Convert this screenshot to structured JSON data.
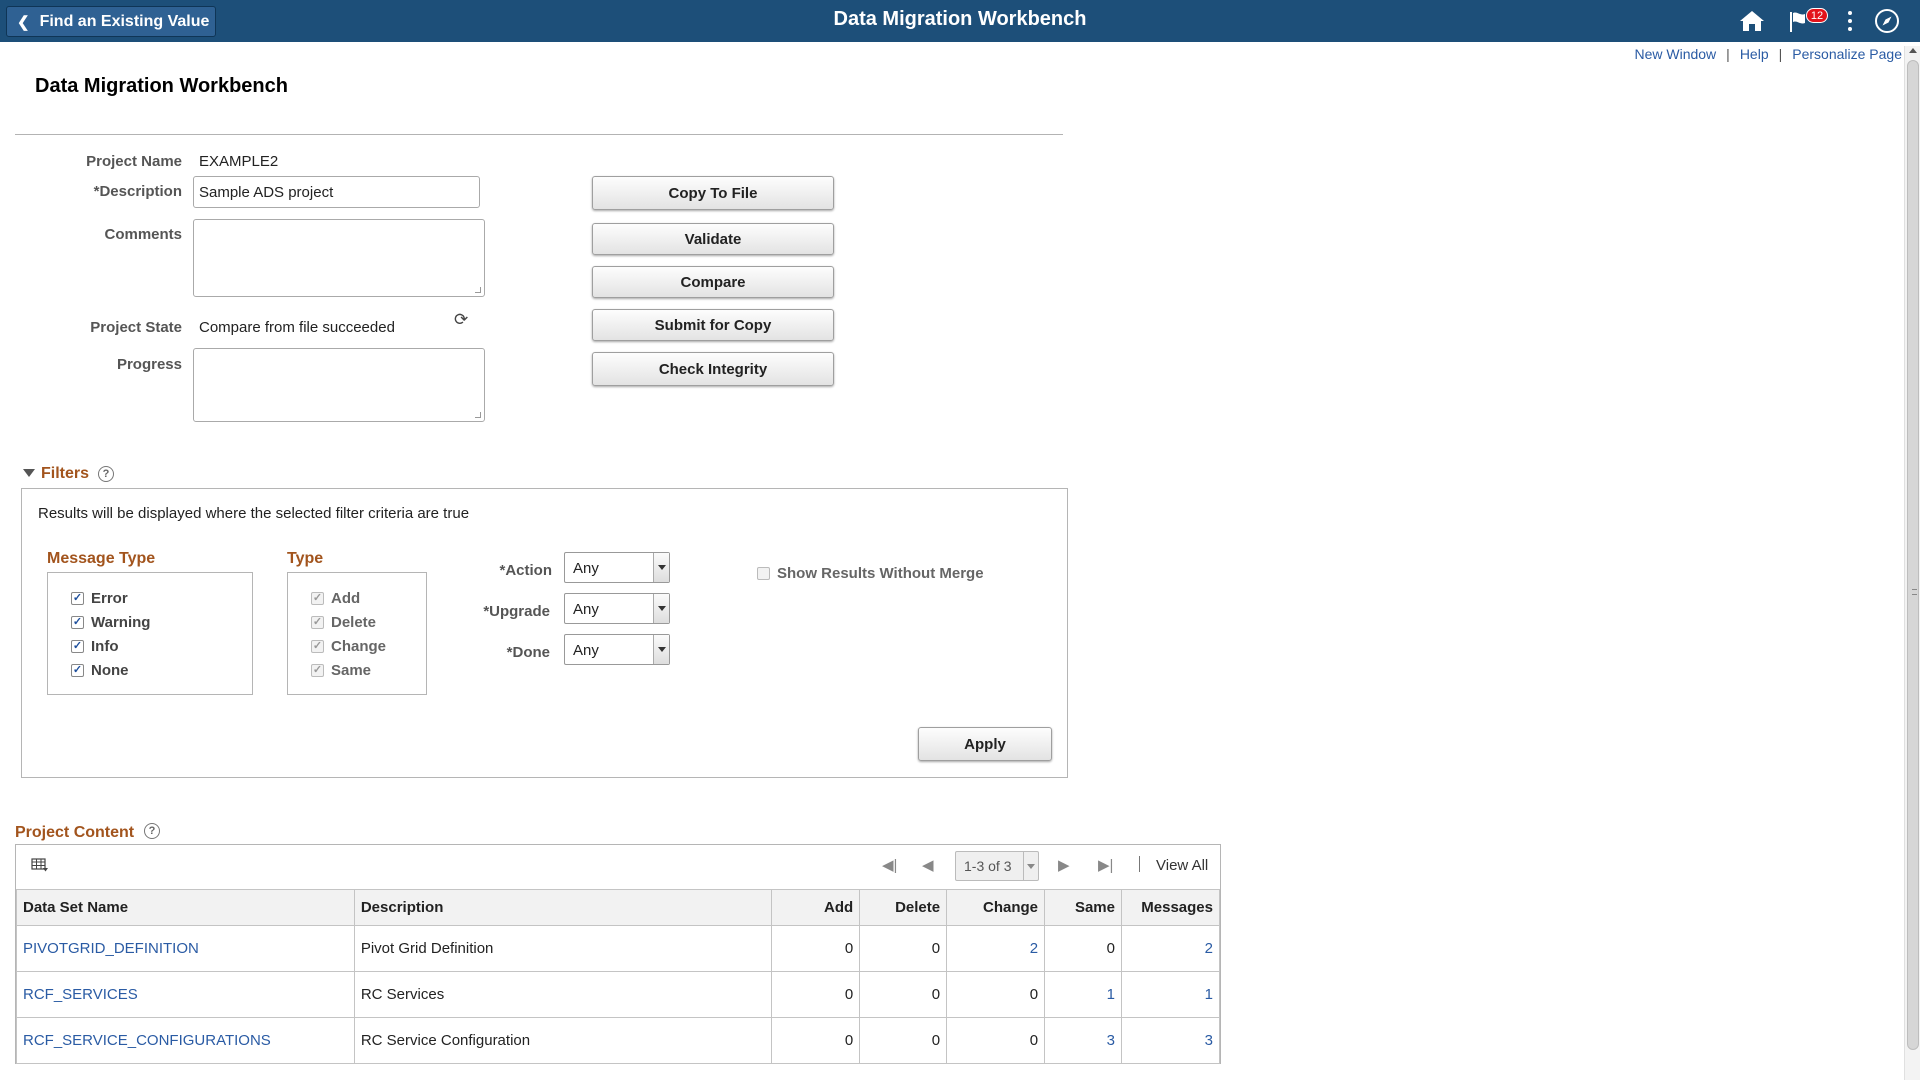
{
  "banner": {
    "back_label": "Find an Existing Value",
    "title": "Data Migration Workbench",
    "notification_count": "12"
  },
  "toplinks": {
    "new_window": "New Window",
    "help": "Help",
    "personalize": "Personalize Page"
  },
  "page": {
    "title": "Data Migration Workbench"
  },
  "form": {
    "project_name_label": "Project Name",
    "project_name": "EXAMPLE2",
    "description_label": "*Description",
    "description_value": "Sample ADS project",
    "comments_label": "Comments",
    "comments_value": "",
    "project_state_label": "Project State",
    "project_state": "Compare from file succeeded",
    "progress_label": "Progress",
    "progress_value": ""
  },
  "actions": {
    "copy_to_file": "Copy To File",
    "validate": "Validate",
    "compare": "Compare",
    "submit_for_copy": "Submit for Copy",
    "check_integrity": "Check Integrity"
  },
  "filters": {
    "title": "Filters",
    "hint": "Results will be displayed where the selected filter criteria are true",
    "message_type": {
      "title": "Message Type",
      "items": [
        {
          "label": "Error",
          "checked": true
        },
        {
          "label": "Warning",
          "checked": true
        },
        {
          "label": "Info",
          "checked": true
        },
        {
          "label": "None",
          "checked": true
        }
      ]
    },
    "type": {
      "title": "Type",
      "items": [
        {
          "label": "Add",
          "checked": true
        },
        {
          "label": "Delete",
          "checked": true
        },
        {
          "label": "Change",
          "checked": true
        },
        {
          "label": "Same",
          "checked": true
        }
      ]
    },
    "action_label": "*Action",
    "action_value": "Any",
    "upgrade_label": "*Upgrade",
    "upgrade_value": "Any",
    "done_label": "*Done",
    "done_value": "Any",
    "show_without_merge": "Show Results Without Merge",
    "apply": "Apply"
  },
  "content": {
    "title": "Project Content",
    "pager": "1-3 of 3",
    "view_all": "View All",
    "columns": [
      "Data Set Name",
      "Description",
      "Add",
      "Delete",
      "Change",
      "Same",
      "Messages"
    ],
    "rows": [
      {
        "name": "PIVOTGRID_DEFINITION",
        "description": "Pivot Grid Definition",
        "add": "0",
        "delete": "0",
        "change": "2",
        "same": "0",
        "messages": "2"
      },
      {
        "name": "RCF_SERVICES",
        "description": "RC Services",
        "add": "0",
        "delete": "0",
        "change": "0",
        "same": "1",
        "messages": "1"
      },
      {
        "name": "RCF_SERVICE_CONFIGURATIONS",
        "description": "RC Service Configuration",
        "add": "0",
        "delete": "0",
        "change": "0",
        "same": "3",
        "messages": "3"
      }
    ]
  },
  "colors": {
    "banner": "#1d4f79",
    "section": "#a2541d",
    "link": "#2a5ba4",
    "badge": "#e3131b"
  }
}
